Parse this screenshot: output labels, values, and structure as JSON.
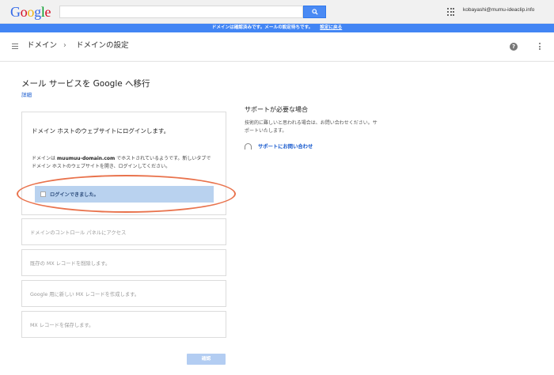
{
  "logo": [
    "G",
    "o",
    "o",
    "g",
    "l",
    "e"
  ],
  "search": {
    "placeholder": ""
  },
  "account": {
    "email": "kobayashi@mumu-ideaclip.info"
  },
  "notice": {
    "text": "ドメインは確認済みです。メールの設定待ちです。",
    "link": "設定に戻る"
  },
  "breadcrumb": {
    "domain": "ドメイン",
    "separator": "›",
    "settings": "ドメインの設定"
  },
  "help": {
    "label": "?"
  },
  "page": {
    "title": "メール サービスを Google へ移行",
    "details": "詳細"
  },
  "step1": {
    "title": "ドメイン ホストのウェブサイトにログインします。",
    "body_prefix": "ドメインは ",
    "body_domain": "muumuu-domain.com",
    "body_suffix": " でホストされているようです。新しいタブでドメイン ホストのウェブサイトを開き、ログインしてください。",
    "checkbox_label": "ログインできました。"
  },
  "steps": [
    "ドメインのコントロール パネルにアクセス",
    "既存の MX レコードを削除します。",
    "Google 用に新しい MX レコードを作成します。",
    "MX レコードを保存します。"
  ],
  "confirm_button": "確認",
  "support": {
    "title": "サポートが必要な場合",
    "text": "技術的に難しいと思われる場合は、お問い合わせください。サポートいたします。",
    "link": "サポートにお問い合わせ"
  }
}
